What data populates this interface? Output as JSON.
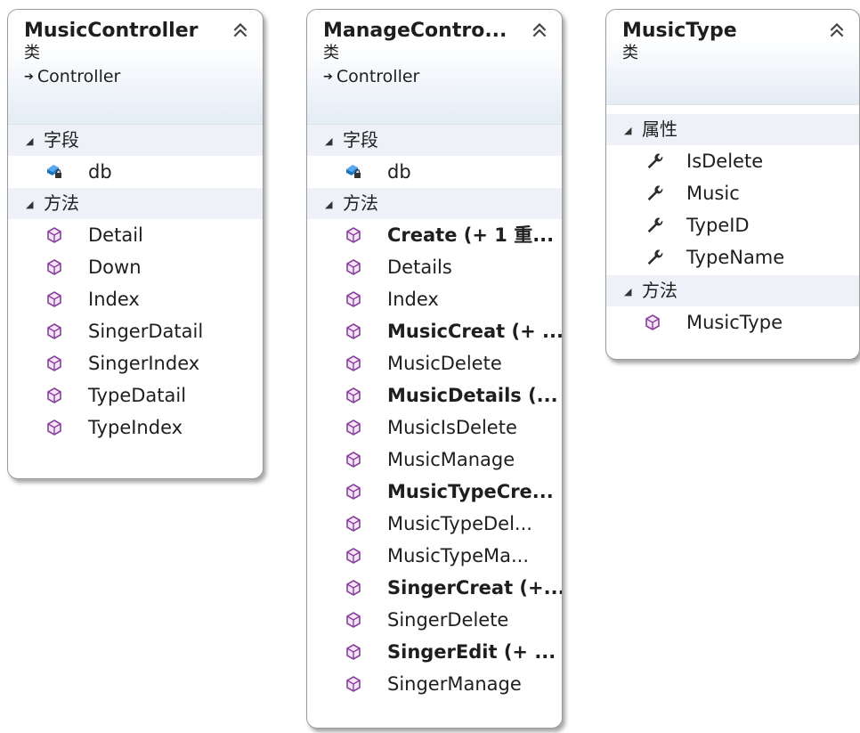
{
  "diagrams": [
    {
      "name": "MusicController",
      "kind": "类",
      "base": "Controller",
      "fields_header": "字段",
      "fields": [
        "db"
      ],
      "methods_header": "方法",
      "methods": [
        {
          "label": "Detail",
          "bold": false
        },
        {
          "label": "Down",
          "bold": false
        },
        {
          "label": "Index",
          "bold": false
        },
        {
          "label": "SingerDatail",
          "bold": false
        },
        {
          "label": "SingerIndex",
          "bold": false
        },
        {
          "label": "TypeDatail",
          "bold": false
        },
        {
          "label": "TypeIndex",
          "bold": false
        }
      ]
    },
    {
      "name": "ManageContro...",
      "kind": "类",
      "base": "Controller",
      "fields_header": "字段",
      "fields": [
        "db"
      ],
      "methods_header": "方法",
      "methods": [
        {
          "label": "Create (+ 1 重...",
          "bold": true
        },
        {
          "label": "Details",
          "bold": false
        },
        {
          "label": "Index",
          "bold": false
        },
        {
          "label": "MusicCreat (+ ...",
          "bold": true
        },
        {
          "label": "MusicDelete",
          "bold": false
        },
        {
          "label": "MusicDetails (...",
          "bold": true
        },
        {
          "label": "MusicIsDelete",
          "bold": false
        },
        {
          "label": "MusicManage",
          "bold": false
        },
        {
          "label": "MusicTypeCre...",
          "bold": true
        },
        {
          "label": "MusicTypeDel...",
          "bold": false
        },
        {
          "label": "MusicTypeMa...",
          "bold": false
        },
        {
          "label": "SingerCreat (+...",
          "bold": true
        },
        {
          "label": "SingerDelete",
          "bold": false
        },
        {
          "label": "SingerEdit (+ ...",
          "bold": true
        },
        {
          "label": "SingerManage",
          "bold": false
        }
      ]
    },
    {
      "name": "MusicType",
      "kind": "类",
      "properties_header": "属性",
      "properties": [
        "IsDelete",
        "Music",
        "TypeID",
        "TypeName"
      ],
      "methods_header": "方法",
      "methods": [
        {
          "label": "MusicType",
          "bold": false
        }
      ]
    }
  ],
  "icons": {
    "collapse": "double-chevron-up-icon",
    "inheritance": "inheritance-arrow-icon",
    "field": "private-field-icon",
    "method": "method-cube-icon",
    "property": "wrench-property-icon",
    "section_toggle": "expanded-triangle-icon"
  },
  "colors": {
    "header_gradient_end": "#e4ecf6",
    "section_bg": "#eef1f7",
    "method_icon": "#8a3f9e",
    "field_icon": "#1c7fd8",
    "property_icon": "#2b2b2b"
  }
}
